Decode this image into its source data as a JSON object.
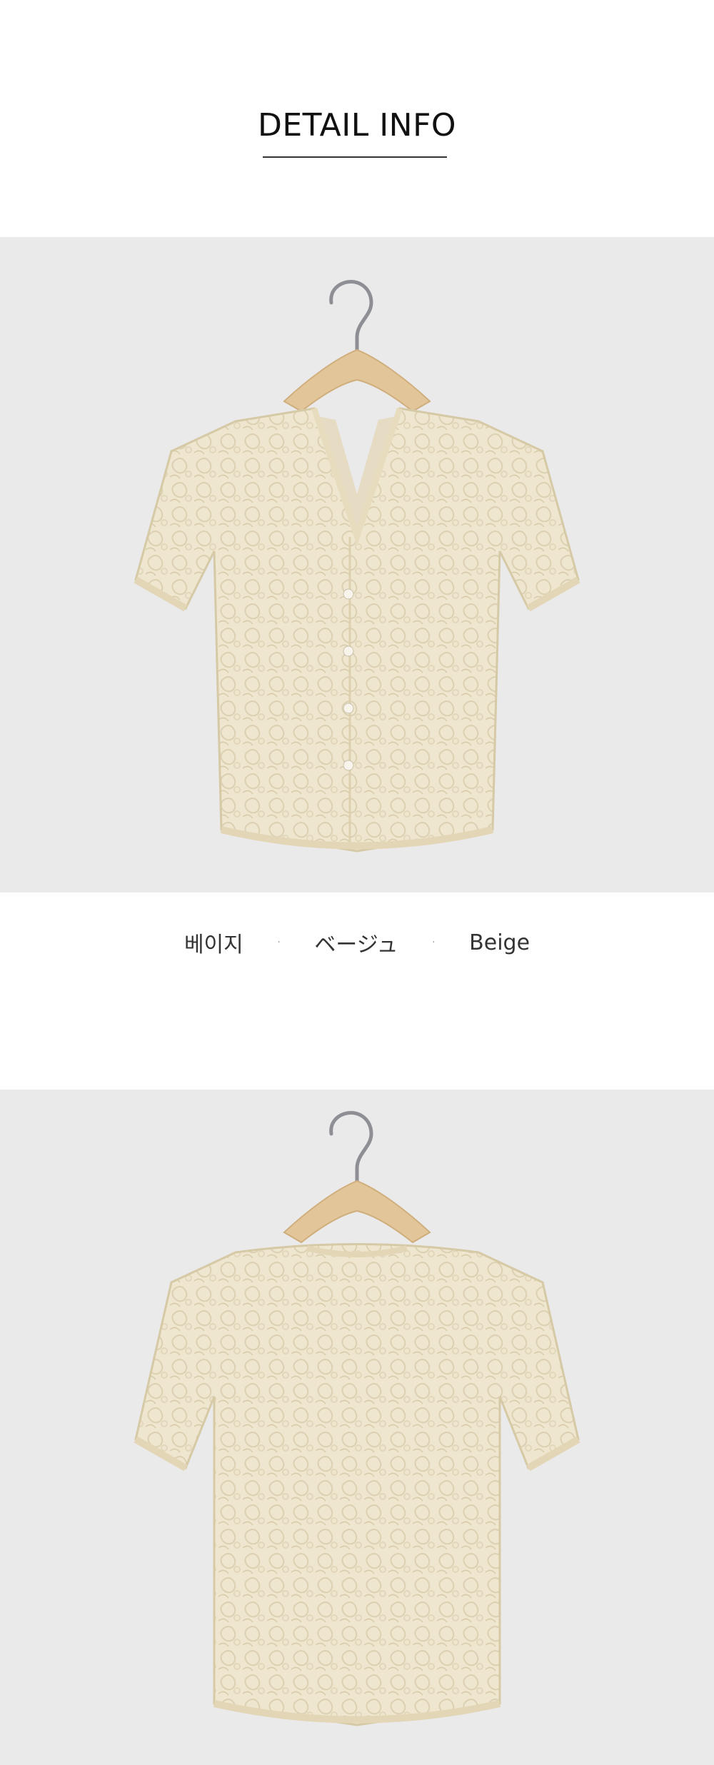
{
  "section_title": "DETAIL INFO",
  "colors": {
    "korean": "베이지",
    "japanese": "ベージュ",
    "english": "Beige",
    "separator": "·"
  },
  "photos": [
    {
      "view": "front",
      "background": "#ebeaea",
      "garment_color": "#efe6cf"
    },
    {
      "view": "back",
      "background": "#ebeaea",
      "garment_color": "#efe6cf"
    }
  ]
}
